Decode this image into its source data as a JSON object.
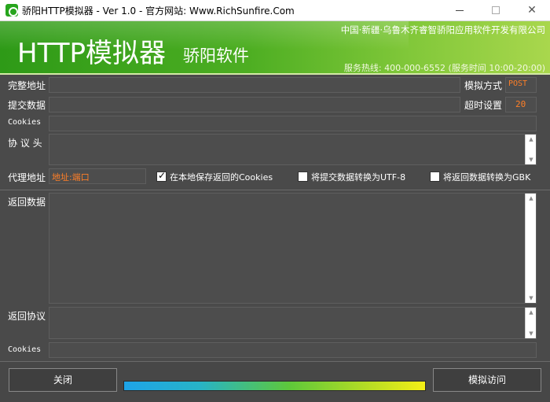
{
  "window": {
    "title": "骄阳HTTP模拟器 - Ver 1.0 - 官方网站: Www.RichSunfire.Com"
  },
  "banner": {
    "title": "HTTP模拟器",
    "subtitle": "骄阳软件",
    "company": "中国·新疆·乌鲁木齐睿智骄阳应用软件开发有限公司",
    "hotline": "服务热线: 400-000-6552 (服务时间 10:00-20:00)"
  },
  "form": {
    "url_label": "完整地址",
    "url_value": "",
    "method_label": "模拟方式",
    "method_value": "POST",
    "post_label": "提交数据",
    "post_value": "",
    "timeout_label": "超时设置",
    "timeout_value": "20",
    "cookies_label": "Cookies",
    "cookies_value": "",
    "headers_label": "协 议 头",
    "headers_value": "",
    "proxy_label": "代理地址",
    "proxy_value": "地址:端口",
    "save_cookies_label": "在本地保存返回的Cookies",
    "save_cookies_checked": true,
    "utf8_label": "将提交数据转换为UTF-8",
    "utf8_checked": false,
    "gbk_label": "将返回数据转换为GBK",
    "gbk_checked": false,
    "response_label": "返回数据",
    "response_value": "",
    "resp_headers_label": "返回协议",
    "resp_headers_value": "",
    "resp_cookies_label": "Cookies",
    "resp_cookies_value": ""
  },
  "footer": {
    "close_label": "关闭",
    "submit_label": "模拟访问",
    "progress": 1.0
  },
  "colors": {
    "accent_green": "#4dae22",
    "value_orange": "#ff7f27",
    "panel": "#4a4a4a"
  }
}
